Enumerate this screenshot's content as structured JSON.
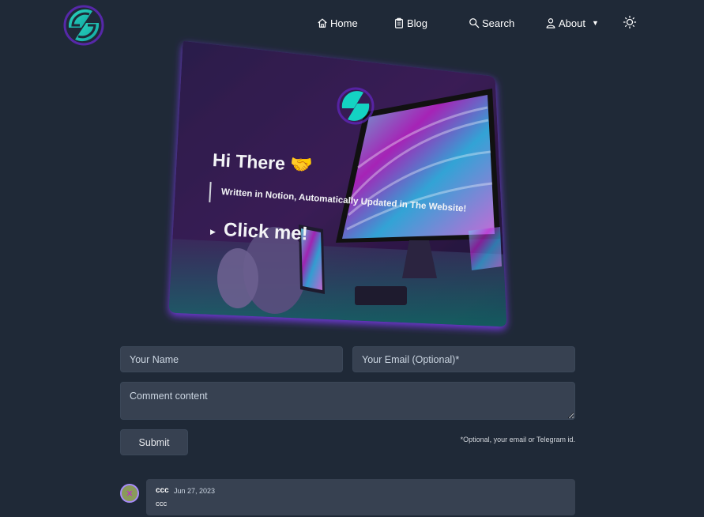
{
  "header": {
    "logo_icon": "site-logo-icon",
    "nav": {
      "home_label": "Home",
      "blog_label": "Blog",
      "search_label": "Search",
      "about_label": "About"
    },
    "theme_icon": "sun-icon"
  },
  "hero": {
    "greeting": "Hi There 🤝",
    "subtitle": "Written in Notion, Automatically Updated in The Website!",
    "cta": "Click me!"
  },
  "form": {
    "name_placeholder": "Your Name",
    "email_placeholder": "Your Email (Optional)*",
    "comment_placeholder": "Comment content",
    "submit_label": "Submit",
    "note": "*Optional, your email or Telegram id."
  },
  "comments": [
    {
      "author": "ccc",
      "date": "Jun 27, 2023",
      "body": "ccc"
    }
  ],
  "colors": {
    "background": "#1f2937",
    "field": "#374151",
    "accent_teal": "#14d3c3",
    "accent_purple": "#8b5cf6"
  }
}
